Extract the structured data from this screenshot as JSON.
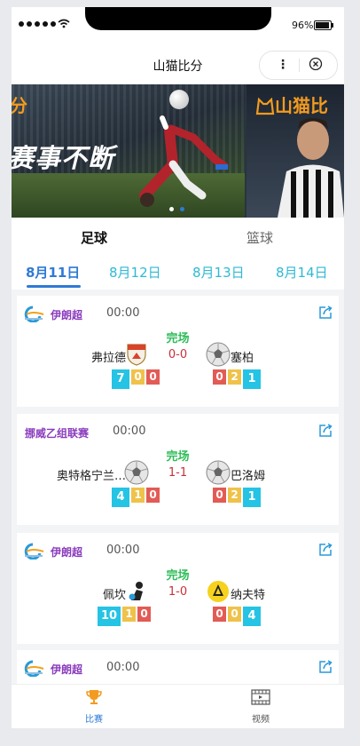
{
  "status_bar": {
    "battery": "96%",
    "battery_level": 0.96
  },
  "nav": {
    "title": "山猫比分",
    "more": "⋮"
  },
  "banner": {
    "brand_text": "分",
    "slogan": "赛事不断",
    "brand_text_2": "山猫比",
    "active_slide": 0
  },
  "sport_tabs": [
    {
      "label": "足球",
      "active": true
    },
    {
      "label": "篮球",
      "active": false
    }
  ],
  "date_tabs": [
    {
      "label": "8月11日",
      "active": true
    },
    {
      "label": "8月12日",
      "active": false
    },
    {
      "label": "8月13日",
      "active": false
    },
    {
      "label": "8月14日",
      "active": false
    }
  ],
  "matches": [
    {
      "league": "伊朗超",
      "time": "00:00",
      "status": "完场",
      "home": "弗拉德",
      "away": "塞柏",
      "score": "0-0",
      "home_stats": [
        "7",
        "0",
        "0"
      ],
      "away_stats": [
        "0",
        "2",
        "1"
      ]
    },
    {
      "league": "挪威乙组联赛",
      "time": "00:00",
      "status": "完场",
      "home": "奥特格宁兰…",
      "away": "巴洛姆",
      "score": "1-1",
      "home_stats": [
        "4",
        "1",
        "0"
      ],
      "away_stats": [
        "0",
        "2",
        "1"
      ]
    },
    {
      "league": "伊朗超",
      "time": "00:00",
      "status": "完场",
      "home": "佩坎",
      "away": "纳夫特",
      "score": "1-0",
      "home_stats": [
        "10",
        "1",
        "0"
      ],
      "away_stats": [
        "0",
        "0",
        "4"
      ]
    },
    {
      "league": "伊朗超",
      "time": "00:00"
    }
  ],
  "tabbar": [
    {
      "label": "比赛",
      "icon": "trophy-icon",
      "active": true
    },
    {
      "label": "视频",
      "icon": "video-icon",
      "active": false
    }
  ],
  "colors": {
    "accent_blue": "#2e7ad6",
    "date_cyan": "#2fb9d4",
    "finished_green": "#2ebd59",
    "score_red": "#c9303a",
    "league_purple": "#8a3bbd",
    "stat_blue": "#25c3e4",
    "stat_yellow": "#efc24a",
    "stat_red": "#e25b55",
    "brand_orange": "#f39b1f"
  }
}
